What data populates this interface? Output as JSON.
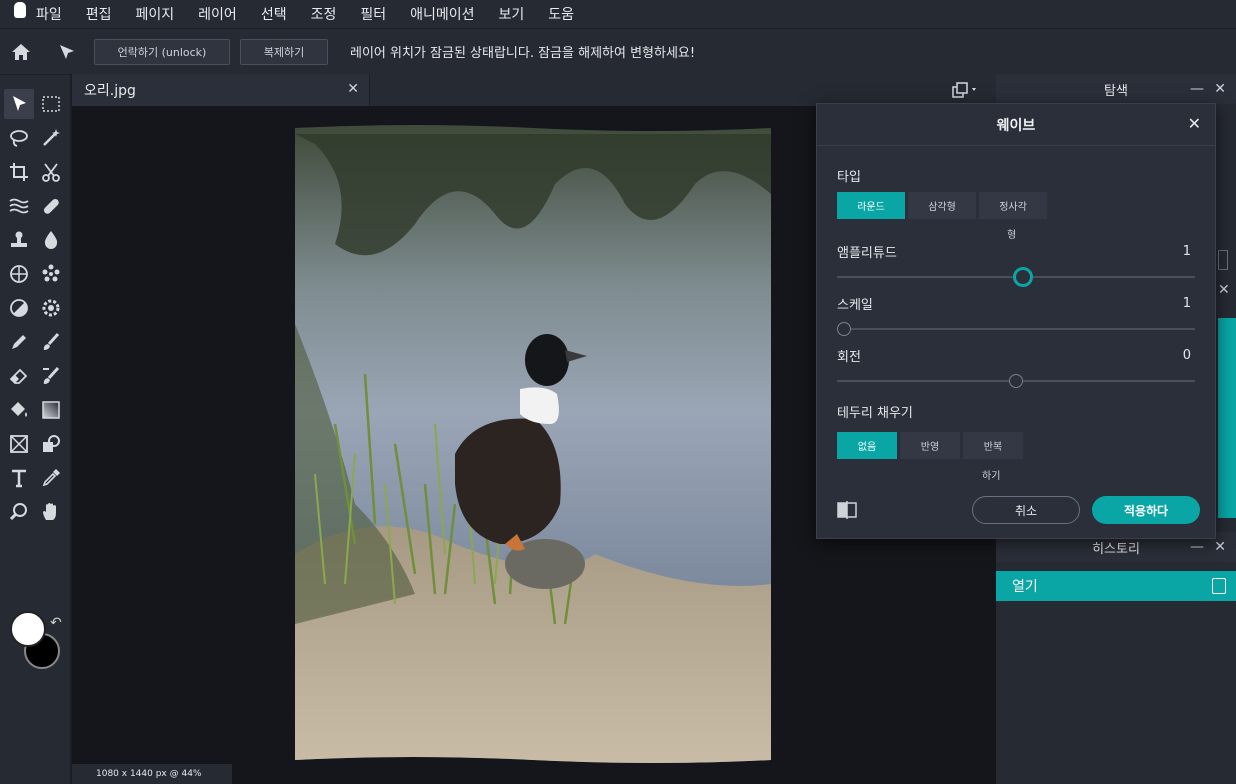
{
  "menu": [
    "파일",
    "편집",
    "페이지",
    "레이어",
    "선택",
    "조정",
    "필터",
    "애니메이션",
    "보기",
    "도움"
  ],
  "options": {
    "unlock_label": "언락하기 (unlock)",
    "duplicate_label": "복제하기",
    "message": "레이어 위치가 잠금된 상태랍니다. 잠금을 해제하여 변형하세요!"
  },
  "document": {
    "tab_name": "오리.jpg",
    "status": "1080 x 1440 px @ 44%"
  },
  "panels": {
    "navigator": "탐색",
    "history": "히스토리",
    "history_item": "열기"
  },
  "wave_dialog": {
    "title": "웨이브",
    "type_label": "타입",
    "types": [
      "라운드",
      "삼각형",
      "정사각"
    ],
    "types_wrap": "형",
    "selected_type": "라운드",
    "amplitude_label": "앰플리튜드",
    "amplitude": "1",
    "amplitude_pos": 0.52,
    "scale_label": "스케일",
    "scale": "1",
    "scale_pos": 0.02,
    "rotation_label": "회전",
    "rotation": "0",
    "rotation_pos": 0.5,
    "edge_label": "테두리 채우기",
    "edges": [
      "없음",
      "반영",
      "반복"
    ],
    "edges_wrap": "하기",
    "selected_edge": "없음",
    "cancel_label": "취소",
    "apply_label": "적용하다"
  },
  "colors": {
    "accent": "#0aa6a6",
    "foreground": "#ffffff",
    "background": "#000000"
  }
}
